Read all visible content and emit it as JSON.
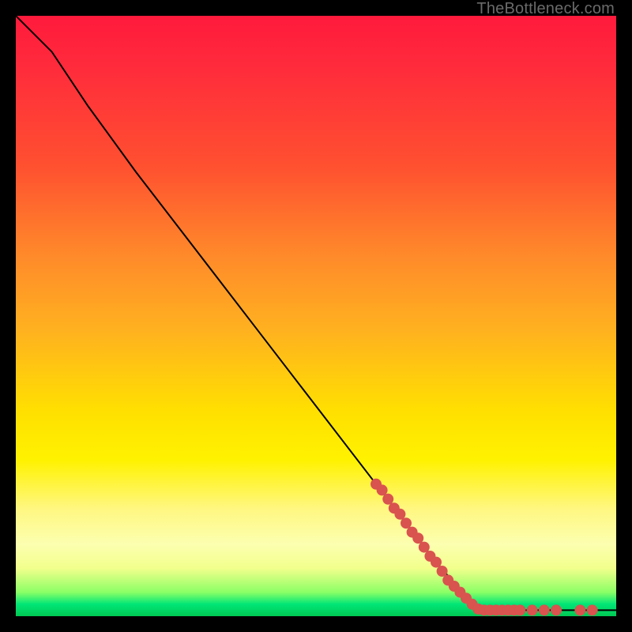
{
  "watermark": "TheBottleneck.com",
  "chart_data": {
    "type": "line",
    "title": "",
    "xlabel": "",
    "ylabel": "",
    "xlim": [
      0,
      100
    ],
    "ylim": [
      0,
      100
    ],
    "grid": false,
    "curve": {
      "name": "bottleneck-curve",
      "points": [
        {
          "x": 0,
          "y": 100
        },
        {
          "x": 6,
          "y": 94
        },
        {
          "x": 12,
          "y": 85
        },
        {
          "x": 20,
          "y": 74
        },
        {
          "x": 30,
          "y": 61
        },
        {
          "x": 40,
          "y": 48
        },
        {
          "x": 50,
          "y": 35
        },
        {
          "x": 60,
          "y": 22
        },
        {
          "x": 70,
          "y": 9
        },
        {
          "x": 77,
          "y": 1
        },
        {
          "x": 100,
          "y": 1
        }
      ]
    },
    "highlight_points": {
      "name": "highlight-segment",
      "color": "#d9534f",
      "points": [
        {
          "x": 60,
          "y": 22
        },
        {
          "x": 61,
          "y": 21
        },
        {
          "x": 62,
          "y": 19.5
        },
        {
          "x": 63,
          "y": 18
        },
        {
          "x": 64,
          "y": 17
        },
        {
          "x": 65,
          "y": 15.5
        },
        {
          "x": 66,
          "y": 14
        },
        {
          "x": 67,
          "y": 13
        },
        {
          "x": 68,
          "y": 11.5
        },
        {
          "x": 69,
          "y": 10
        },
        {
          "x": 70,
          "y": 9
        },
        {
          "x": 71,
          "y": 7.5
        },
        {
          "x": 72,
          "y": 6
        },
        {
          "x": 73,
          "y": 5
        },
        {
          "x": 74,
          "y": 4
        },
        {
          "x": 75,
          "y": 3
        },
        {
          "x": 76,
          "y": 2
        },
        {
          "x": 77,
          "y": 1.2
        },
        {
          "x": 78,
          "y": 1
        },
        {
          "x": 79,
          "y": 1
        },
        {
          "x": 80,
          "y": 1
        },
        {
          "x": 81,
          "y": 1
        },
        {
          "x": 82,
          "y": 1
        },
        {
          "x": 83,
          "y": 1
        },
        {
          "x": 84,
          "y": 1
        },
        {
          "x": 86,
          "y": 1
        },
        {
          "x": 88,
          "y": 1
        },
        {
          "x": 90,
          "y": 1
        },
        {
          "x": 94,
          "y": 1
        },
        {
          "x": 96,
          "y": 1
        }
      ]
    }
  }
}
